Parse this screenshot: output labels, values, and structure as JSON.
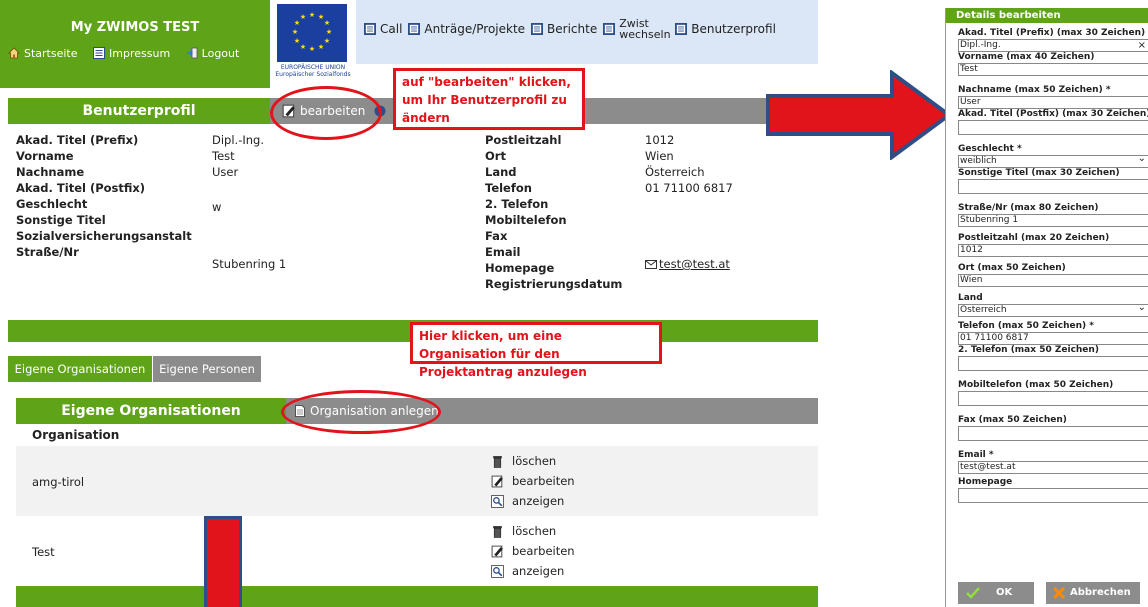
{
  "app": {
    "title": "My ZWIMOS TEST",
    "topnav": [
      "Startseite",
      "Impressum",
      "Logout"
    ],
    "eu_logo_text": "EUROPÄISCHE UNION Europäischer Sozialfonds"
  },
  "mainnav": {
    "items": [
      "Call",
      "Anträge/Projekte",
      "Berichte",
      "Zwist wechseln",
      "Benutzerprofil"
    ]
  },
  "profile": {
    "section_title": "Benutzerprofil",
    "edit_label": "bearbeiten",
    "left_fields": [
      {
        "label": "Akad. Titel (Prefix)",
        "value": "Dipl.-Ing."
      },
      {
        "label": "Vorname",
        "value": "Test"
      },
      {
        "label": "Nachname",
        "value": "User"
      },
      {
        "label": "Akad. Titel (Postfix)",
        "value": ""
      },
      {
        "label": "Geschlecht",
        "value": "w"
      },
      {
        "label": "Sonstige Titel",
        "value": ""
      },
      {
        "label": "Sozialversicherungsanstalt",
        "value": ""
      },
      {
        "label": "Straße/Nr",
        "value": "Stubenring 1"
      }
    ],
    "right_fields": [
      {
        "label": "Postleitzahl",
        "value": "1012"
      },
      {
        "label": "Ort",
        "value": "Wien"
      },
      {
        "label": "Land",
        "value": "Österreich"
      },
      {
        "label": "Telefon",
        "value": "01 71100 6817"
      },
      {
        "label": "2. Telefon",
        "value": ""
      },
      {
        "label": "Mobiltelefon",
        "value": ""
      },
      {
        "label": "Fax",
        "value": ""
      },
      {
        "label": "Email",
        "value": "test@test.at"
      },
      {
        "label": "Homepage",
        "value": ""
      },
      {
        "label": "Registrierungsdatum",
        "value": ""
      }
    ]
  },
  "callouts": {
    "edit_hint": "auf \"bearbeiten\" klicken, um Ihr Benutzerprofil zu ändern",
    "org_hint": "Hier klicken, um eine Organisation für den Projektantrag anzulegen"
  },
  "tabs": [
    "Eigene Organisationen",
    "Eigene Personen"
  ],
  "organisations": {
    "section_title": "Eigene Organisationen",
    "create_label": "Organisation anlegen",
    "column_header": "Organisation",
    "rows": [
      {
        "name": "amg-tirol",
        "actions": [
          "löschen",
          "bearbeiten",
          "anzeigen"
        ]
      },
      {
        "name": "Test",
        "actions": [
          "löschen",
          "bearbeiten",
          "anzeigen"
        ]
      }
    ]
  },
  "dialog": {
    "title": "Details bearbeiten",
    "fields": [
      {
        "label": "Akad. Titel (Prefix) (max 30 Zeichen)",
        "value": "Dipl.-Ing.",
        "type": "text-clear"
      },
      {
        "label": "Vorname (max 40 Zeichen)",
        "value": "Test",
        "type": "text"
      },
      {
        "label": "Nachname (max 50 Zeichen) *",
        "value": "User",
        "type": "text"
      },
      {
        "label": "Akad. Titel (Postfix) (max 30 Zeichen)",
        "value": "",
        "type": "text"
      },
      {
        "label": "Geschlecht *",
        "value": "weiblich",
        "type": "select"
      },
      {
        "label": "Sonstige Titel (max 30 Zeichen)",
        "value": "",
        "type": "text"
      },
      {
        "label": "Straße/Nr (max 80 Zeichen)",
        "value": "Stubenring 1",
        "type": "text"
      },
      {
        "label": "Postleitzahl (max 20 Zeichen)",
        "value": "1012",
        "type": "text"
      },
      {
        "label": "Ort (max 50 Zeichen)",
        "value": "Wien",
        "type": "text"
      },
      {
        "label": "Land",
        "value": "Österreich",
        "type": "select"
      },
      {
        "label": "Telefon (max 50 Zeichen) *",
        "value": "01 71100 6817",
        "type": "text"
      },
      {
        "label": "2. Telefon (max 50 Zeichen)",
        "value": "",
        "type": "text"
      },
      {
        "label": "Mobiltelefon (max 50 Zeichen)",
        "value": "",
        "type": "text"
      },
      {
        "label": "Fax (max 50 Zeichen)",
        "value": "",
        "type": "text"
      },
      {
        "label": "Email *",
        "value": "test@test.at",
        "type": "text"
      },
      {
        "label": "Homepage",
        "value": "",
        "type": "text"
      }
    ],
    "ok_label": "OK",
    "cancel_label": "Abbrechen",
    "clear_glyph": "×"
  },
  "colors": {
    "green": "#5fa418",
    "grey": "#8c8c8c",
    "nav_bg": "#dbe7f6",
    "annotation_red": "#e2141b",
    "arrow_border": "#2e4f86"
  }
}
